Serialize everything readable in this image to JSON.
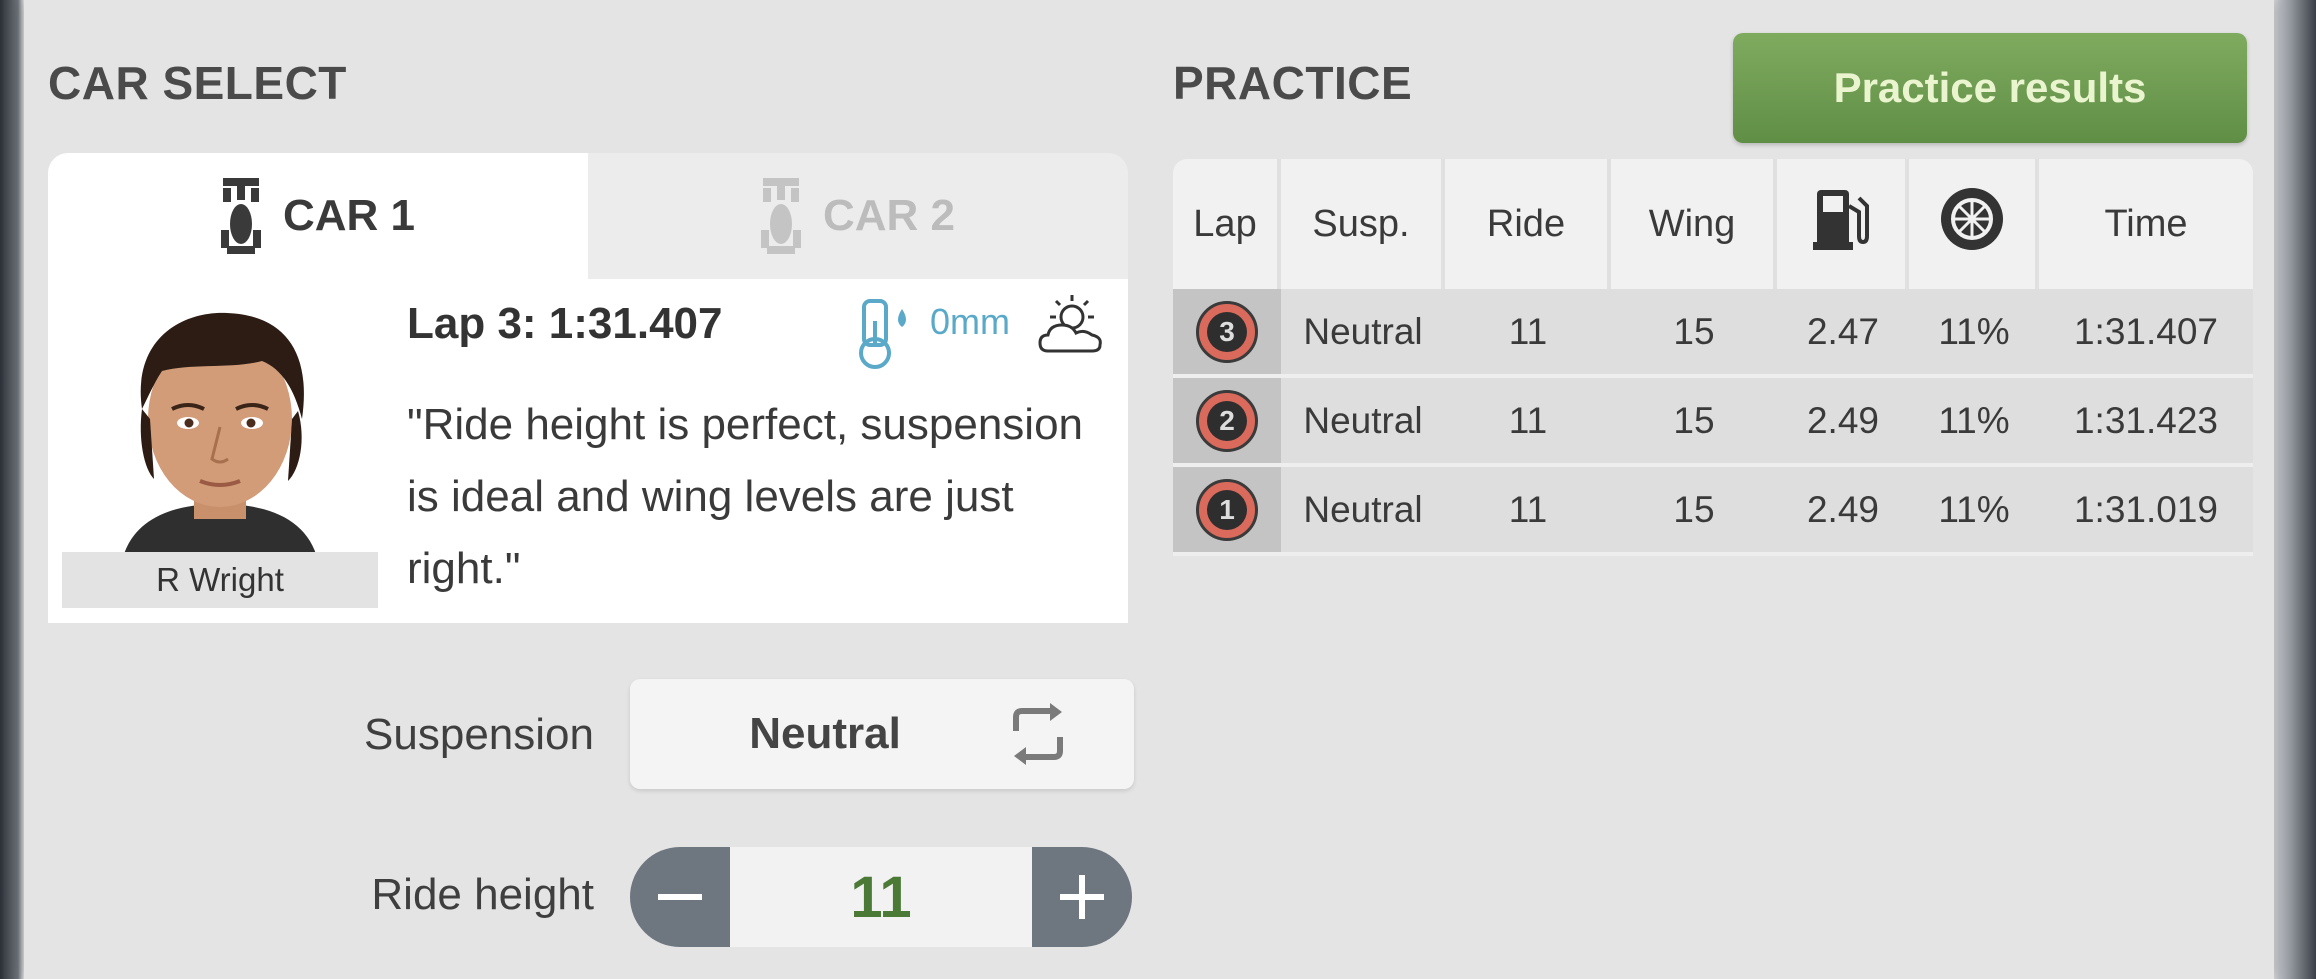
{
  "car_select": {
    "title": "CAR SELECT",
    "tabs": [
      {
        "label": "CAR 1",
        "active": true
      },
      {
        "label": "CAR 2",
        "active": false
      }
    ],
    "driver": {
      "name": "R Wright"
    },
    "lap_title": "Lap 3: 1:31.407",
    "rain": "0mm",
    "weather_icon": "partly-cloudy-icon",
    "quote": "\"Ride height is perfect, suspension is ideal and wing levels are just right.\"",
    "suspension": {
      "label": "Suspension",
      "value": "Neutral"
    },
    "ride_height": {
      "label": "Ride height",
      "value": "11"
    }
  },
  "practice": {
    "title": "PRACTICE",
    "results_button": "Practice results",
    "headers": [
      "Lap",
      "Susp.",
      "Ride",
      "Wing",
      "fuel-icon",
      "tyre-icon",
      "Time"
    ],
    "rows": [
      {
        "lap": "3",
        "susp": "Neutral",
        "ride": "11",
        "wing": "15",
        "fuel": "2.47",
        "tyre": "11%",
        "time": "1:31.407"
      },
      {
        "lap": "2",
        "susp": "Neutral",
        "ride": "11",
        "wing": "15",
        "fuel": "2.49",
        "tyre": "11%",
        "time": "1:31.423"
      },
      {
        "lap": "1",
        "susp": "Neutral",
        "ride": "11",
        "wing": "15",
        "fuel": "2.49",
        "tyre": "11%",
        "time": "1:31.019"
      }
    ]
  },
  "colors": {
    "accent_green": "#6a9a4e",
    "tyre_badge": "#d96a5c",
    "rain_blue": "#5aa9c8",
    "stepper_grey": "#6e7680"
  }
}
